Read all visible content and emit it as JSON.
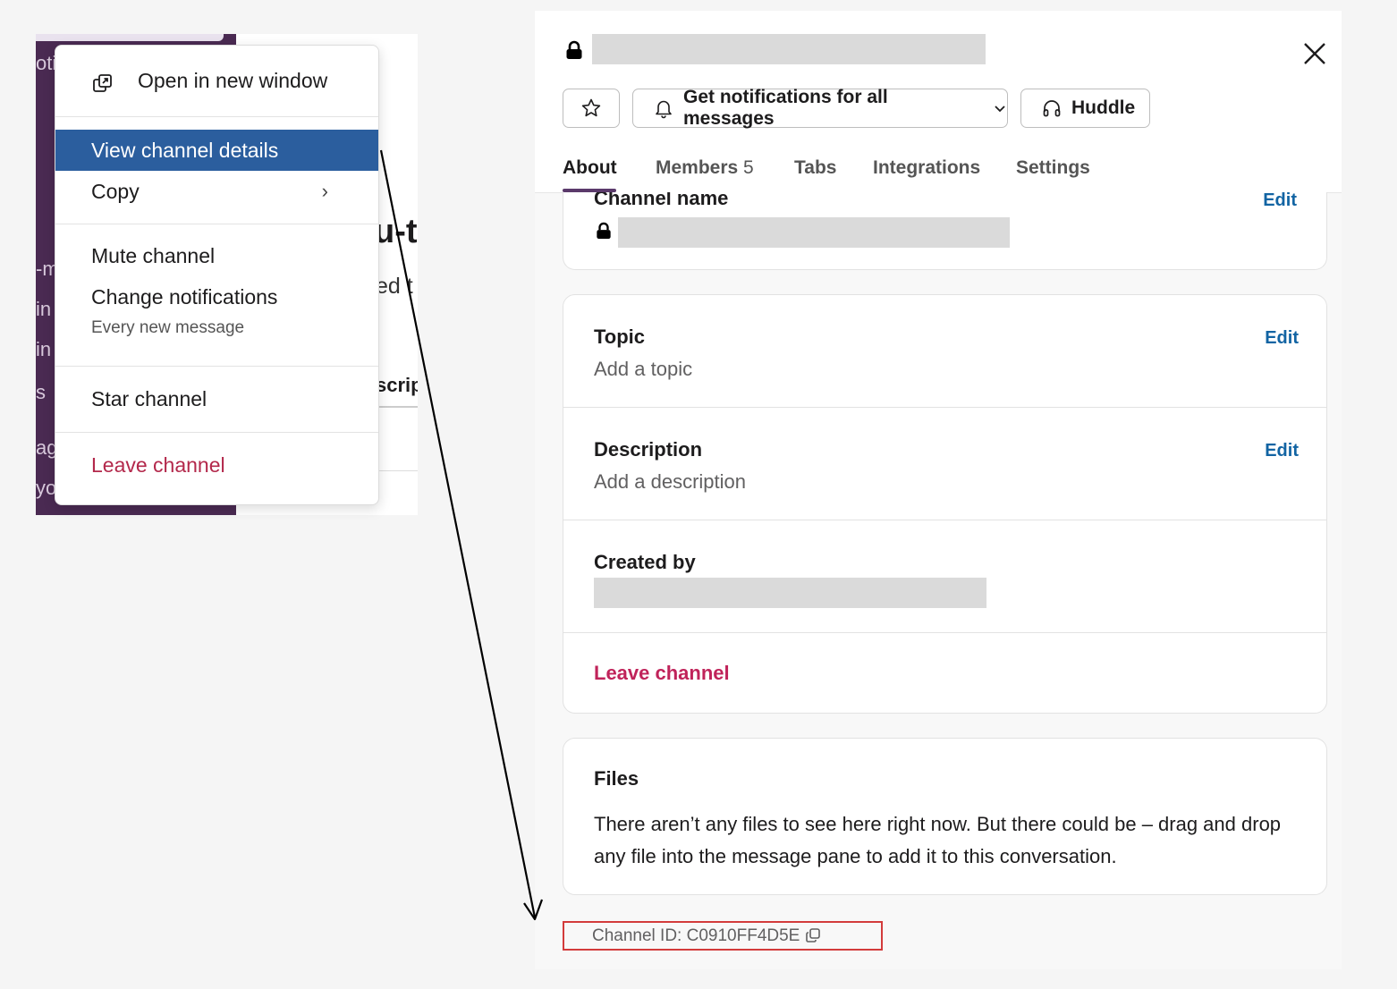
{
  "left_app": {
    "sidebar_fragments": [
      "oti",
      "-m",
      "in",
      "in",
      "s",
      "ag",
      "yo"
    ],
    "channel_title_fragment": "u-t",
    "channel_sub_fragment": "ed t",
    "channel_tab_fragment": "scrip"
  },
  "context_menu": {
    "open_new_window": "Open in new window",
    "view_channel_details": "View channel details",
    "copy": "Copy",
    "copy_chevron": "›",
    "mute_channel": "Mute channel",
    "change_notifications": "Change notifications",
    "notifications_sub": "Every new message",
    "star_channel": "Star channel",
    "leave_channel": "Leave channel"
  },
  "panel": {
    "header": {
      "notifications_button": "Get notifications for all messages",
      "huddle_button": "Huddle"
    },
    "tabs": [
      {
        "label": "About"
      },
      {
        "label": "Members",
        "count": "5"
      },
      {
        "label": "Tabs"
      },
      {
        "label": "Integrations"
      },
      {
        "label": "Settings"
      }
    ],
    "channel_name": {
      "label": "Channel name",
      "edit": "Edit"
    },
    "topic": {
      "label": "Topic",
      "value": "Add a topic",
      "edit": "Edit"
    },
    "description": {
      "label": "Description",
      "value": "Add a description",
      "edit": "Edit"
    },
    "created_by": {
      "label": "Created by"
    },
    "leave": "Leave channel",
    "files": {
      "label": "Files",
      "text": "There aren’t any files to see here right now. But there could be – drag and drop any file into the message pane to add it to this conversation."
    },
    "channel_id": "Channel ID: C0910FF4D5E"
  },
  "colors": {
    "highlight": "#2b5e9e",
    "danger": "#c0235a",
    "link": "#1264a3",
    "sidebar": "#4a2a52",
    "annotation": "#d33b3b"
  },
  "icons": [
    "open-window-icon",
    "chevron-right-icon",
    "lock-icon",
    "close-icon",
    "star-icon",
    "bell-icon",
    "chevron-down-icon",
    "headphones-icon",
    "copy-icon",
    "annotation-arrow"
  ]
}
